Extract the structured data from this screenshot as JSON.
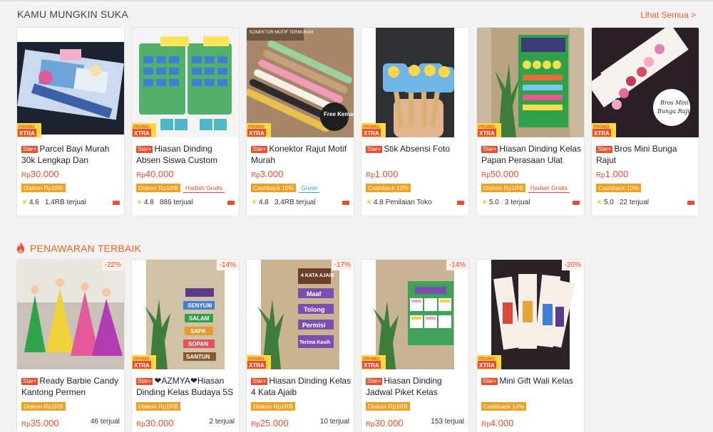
{
  "section1": {
    "title": "KAMU MUNGKIN SUKA",
    "see_all": "Lihat Semua"
  },
  "section2": {
    "title": "PENAWARAN TERBAIK"
  },
  "badges": {
    "star": "Star+",
    "currency": "Rp"
  },
  "colors": {
    "accent": "#ee4d2d",
    "orange": "#f06022",
    "tag_yellow": "#f0a020",
    "star": "#ffce3d"
  },
  "row1": [
    {
      "name": "Parcel Bayi Murah 30k Lengkap Dan Hemat...",
      "price": "30.000",
      "tags": [
        "Diskon Rp1RB"
      ],
      "rating": "4.6",
      "sold": "1,4RB terjual"
    },
    {
      "name": "Hiasan Dinding Absen Siswa Custom Desain...",
      "price": "40.000",
      "tags": [
        "Diskon Rp1RB",
        "Hadiah Gratis"
      ],
      "rating": "4.8",
      "sold": "886 terjual"
    },
    {
      "name": "Konektor Rajut Motif Murah",
      "price": "3.000",
      "tags": [
        "Cashback 10%",
        "Grosir"
      ],
      "rating": "4.8",
      "sold": "3,4RB terjual",
      "image_caption": "Free Kemas",
      "image_header": "KONEKTOR MOTIF TERMURAH"
    },
    {
      "name": "Stik Absensi Foto",
      "price": "1.000",
      "tags": [
        "Cashback 10%"
      ],
      "rating": "4.8",
      "sold": "Penilaian Toko"
    },
    {
      "name": "Hiasan Dinding Kelas Papan Perasaan Ulat",
      "price": "50.000",
      "tags": [
        "Diskon Rp1RB",
        "Hadiah Gratis"
      ],
      "rating": "5.0",
      "sold": "3 terjual"
    },
    {
      "name": "Bros Mini Bunga Rajut",
      "price": "1.000",
      "tags": [
        "Cashback 10%"
      ],
      "rating": "5.0",
      "sold": "22 terjual",
      "image_caption": "Bros Mini Bunga Rajut"
    }
  ],
  "row2": [
    {
      "name": "Ready Barbie Candy Kantong Permen Warna-...",
      "price": "35.000",
      "tags": [
        "Diskon Rp1RB"
      ],
      "sold": "46 terjual",
      "discount": "-22%"
    },
    {
      "name": "❤AZMYA❤Hiasan Dinding Kelas Budaya 5S",
      "price": "30.000",
      "tags": [
        "Diskon Rp1RB"
      ],
      "sold": "2 terjual",
      "discount": "-14%",
      "image_words": [
        "SENYUM",
        "SALAM",
        "SAPA",
        "SOPAN",
        "SANTUN"
      ]
    },
    {
      "name": "Hiasan Dinding Kelas 4 Kata Ajaib",
      "price": "25.000",
      "tags": [
        "Diskon Rp1RB"
      ],
      "sold": "10 terjual",
      "discount": "-17%",
      "image_words": [
        "4 KATA AJAIB",
        "Maaf",
        "Tolong",
        "Permisi",
        "Terima Kasih"
      ]
    },
    {
      "name": "Hiasan Dinding Jadwal Piket Kelas",
      "price": "30.000",
      "tags": [
        "Diskon Rp1RB"
      ],
      "sold": "153 terjual",
      "discount": "-14%"
    },
    {
      "name": "Mini Gift Wali Kelas",
      "price": "4.000",
      "tags": [
        "Cashback 10%"
      ],
      "sold": "",
      "discount": "-20%"
    }
  ]
}
